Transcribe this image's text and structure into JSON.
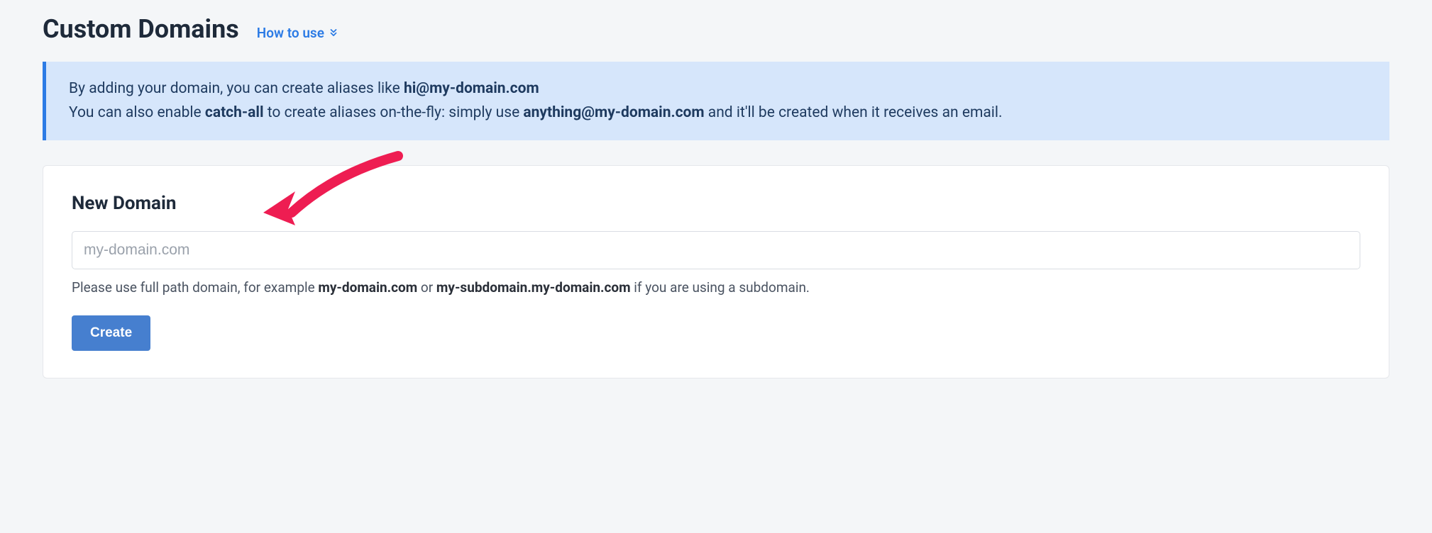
{
  "header": {
    "title": "Custom Domains",
    "howToUse": "How to use"
  },
  "infoBox": {
    "line1_prefix": "By adding your domain, you can create aliases like ",
    "line1_bold": "hi@my-domain.com",
    "line2_prefix": "You can also enable ",
    "line2_bold1": "catch-all",
    "line2_mid": " to create aliases on-the-fly: simply use ",
    "line2_bold2": "anything@my-domain.com",
    "line2_suffix": " and it'll be created when it receives an email."
  },
  "card": {
    "title": "New Domain",
    "input_placeholder": "my-domain.com",
    "input_value": "",
    "helper_prefix": "Please use full path domain, for example ",
    "helper_bold1": "my-domain.com",
    "helper_mid": " or ",
    "helper_bold2": "my-subdomain.my-domain.com",
    "helper_suffix": " if you are using a subdomain.",
    "create_label": "Create"
  },
  "annotation": {
    "arrow_color": "#ee1d52"
  }
}
